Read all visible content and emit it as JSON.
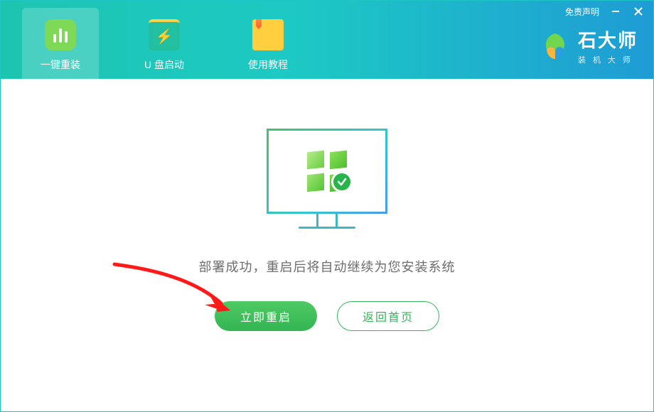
{
  "titlebar": {
    "disclaimer": "免责声明"
  },
  "tabs": [
    {
      "label": "一键重装"
    },
    {
      "label": "U 盘启动"
    },
    {
      "label": "使用教程"
    }
  ],
  "brand": {
    "name": "石大师",
    "subtitle": "装机大师"
  },
  "main": {
    "status": "部署成功，重启后将自动继续为您安装系统",
    "primary_btn": "立即重启",
    "secondary_btn": "返回首页"
  }
}
